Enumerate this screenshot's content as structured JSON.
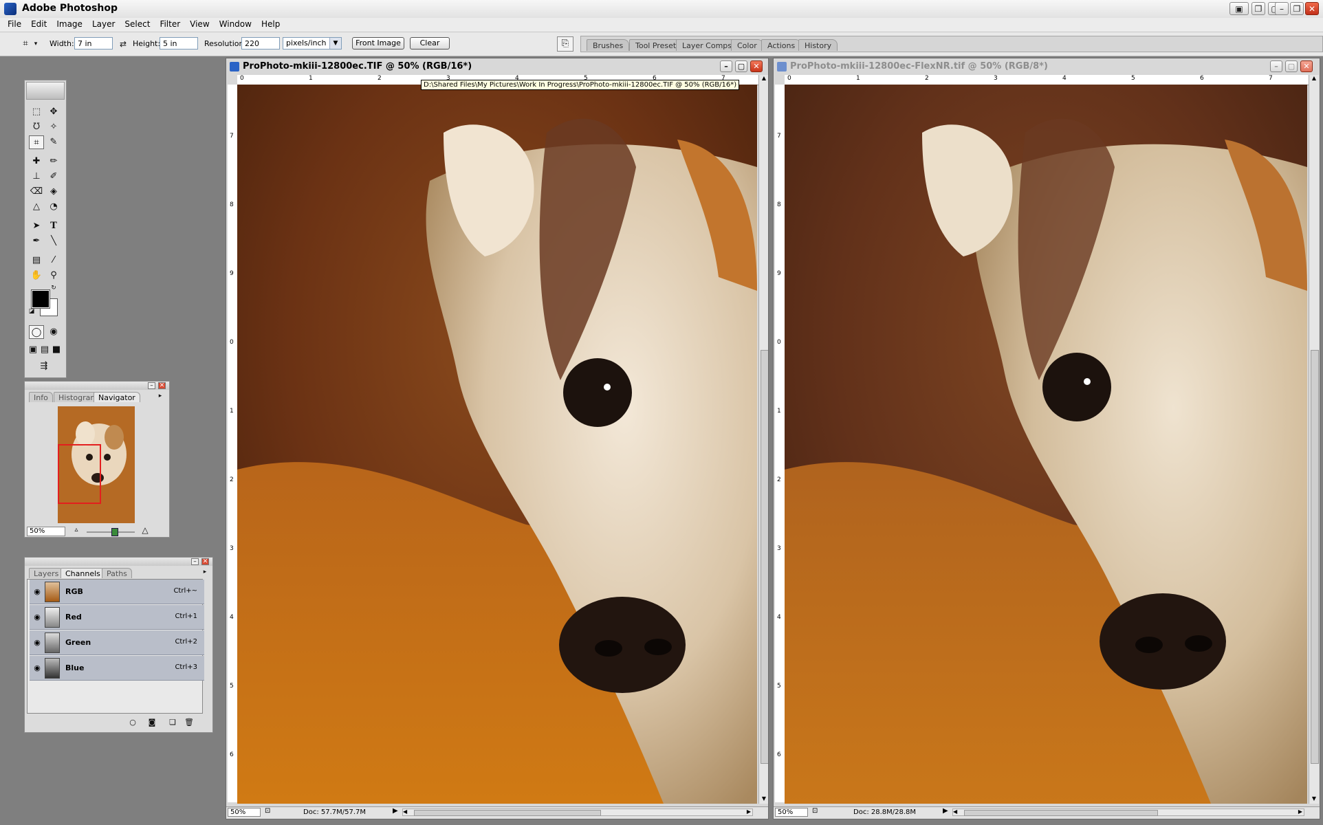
{
  "app": {
    "title": "Adobe Photoshop"
  },
  "menu": [
    "File",
    "Edit",
    "Image",
    "Layer",
    "Select",
    "Filter",
    "View",
    "Window",
    "Help"
  ],
  "options": {
    "width_label": "Width:",
    "width_value": "7 in",
    "height_label": "Height:",
    "height_value": "5 in",
    "resolution_label": "Resolution:",
    "resolution_value": "220",
    "units_value": "pixels/inch",
    "front_image": "Front Image",
    "clear": "Clear"
  },
  "palette_well": [
    "Brushes",
    "Tool Presets",
    "Layer Comps",
    "Color",
    "Actions",
    "History"
  ],
  "navigator": {
    "tabs": [
      "Info",
      "Histogram",
      "Navigator"
    ],
    "zoom": "50%"
  },
  "channels": {
    "tabs": [
      "Layers",
      "Channels",
      "Paths"
    ],
    "rows": [
      {
        "name": "RGB",
        "shortcut": "Ctrl+~"
      },
      {
        "name": "Red",
        "shortcut": "Ctrl+1"
      },
      {
        "name": "Green",
        "shortcut": "Ctrl+2"
      },
      {
        "name": "Blue",
        "shortcut": "Ctrl+3"
      }
    ]
  },
  "doc1": {
    "title": "ProPhoto-mkiii-12800ec.TIF @ 50% (RGB/16*)",
    "tooltip": "D:\\Shared Files\\My Pictures\\Work In Progress\\ProPhoto-mkiii-12800ec.TIF @ 50% (RGB/16*)",
    "zoom": "50%",
    "doc_size": "Doc: 57.7M/57.7M",
    "ruler_h": [
      "0",
      "1",
      "2",
      "3",
      "4",
      "5",
      "6",
      "7"
    ],
    "ruler_v": [
      "7",
      "8",
      "9",
      "0",
      "1",
      "2",
      "3",
      "4",
      "5",
      "6"
    ]
  },
  "doc2": {
    "title": "ProPhoto-mkiii-12800ec-FlexNR.tif @ 50% (RGB/8*)",
    "zoom": "50%",
    "doc_size": "Doc: 28.8M/28.8M",
    "ruler_h": [
      "0",
      "1",
      "2",
      "3",
      "4",
      "5",
      "6",
      "7"
    ],
    "ruler_v": [
      "7",
      "8",
      "9",
      "0",
      "1",
      "2",
      "3",
      "4",
      "5",
      "6"
    ]
  },
  "colors": {
    "accent": "#2a63c6",
    "close": "#d84a33",
    "dog_fur": "#efe3d0",
    "background_orange": "#c0700f"
  }
}
